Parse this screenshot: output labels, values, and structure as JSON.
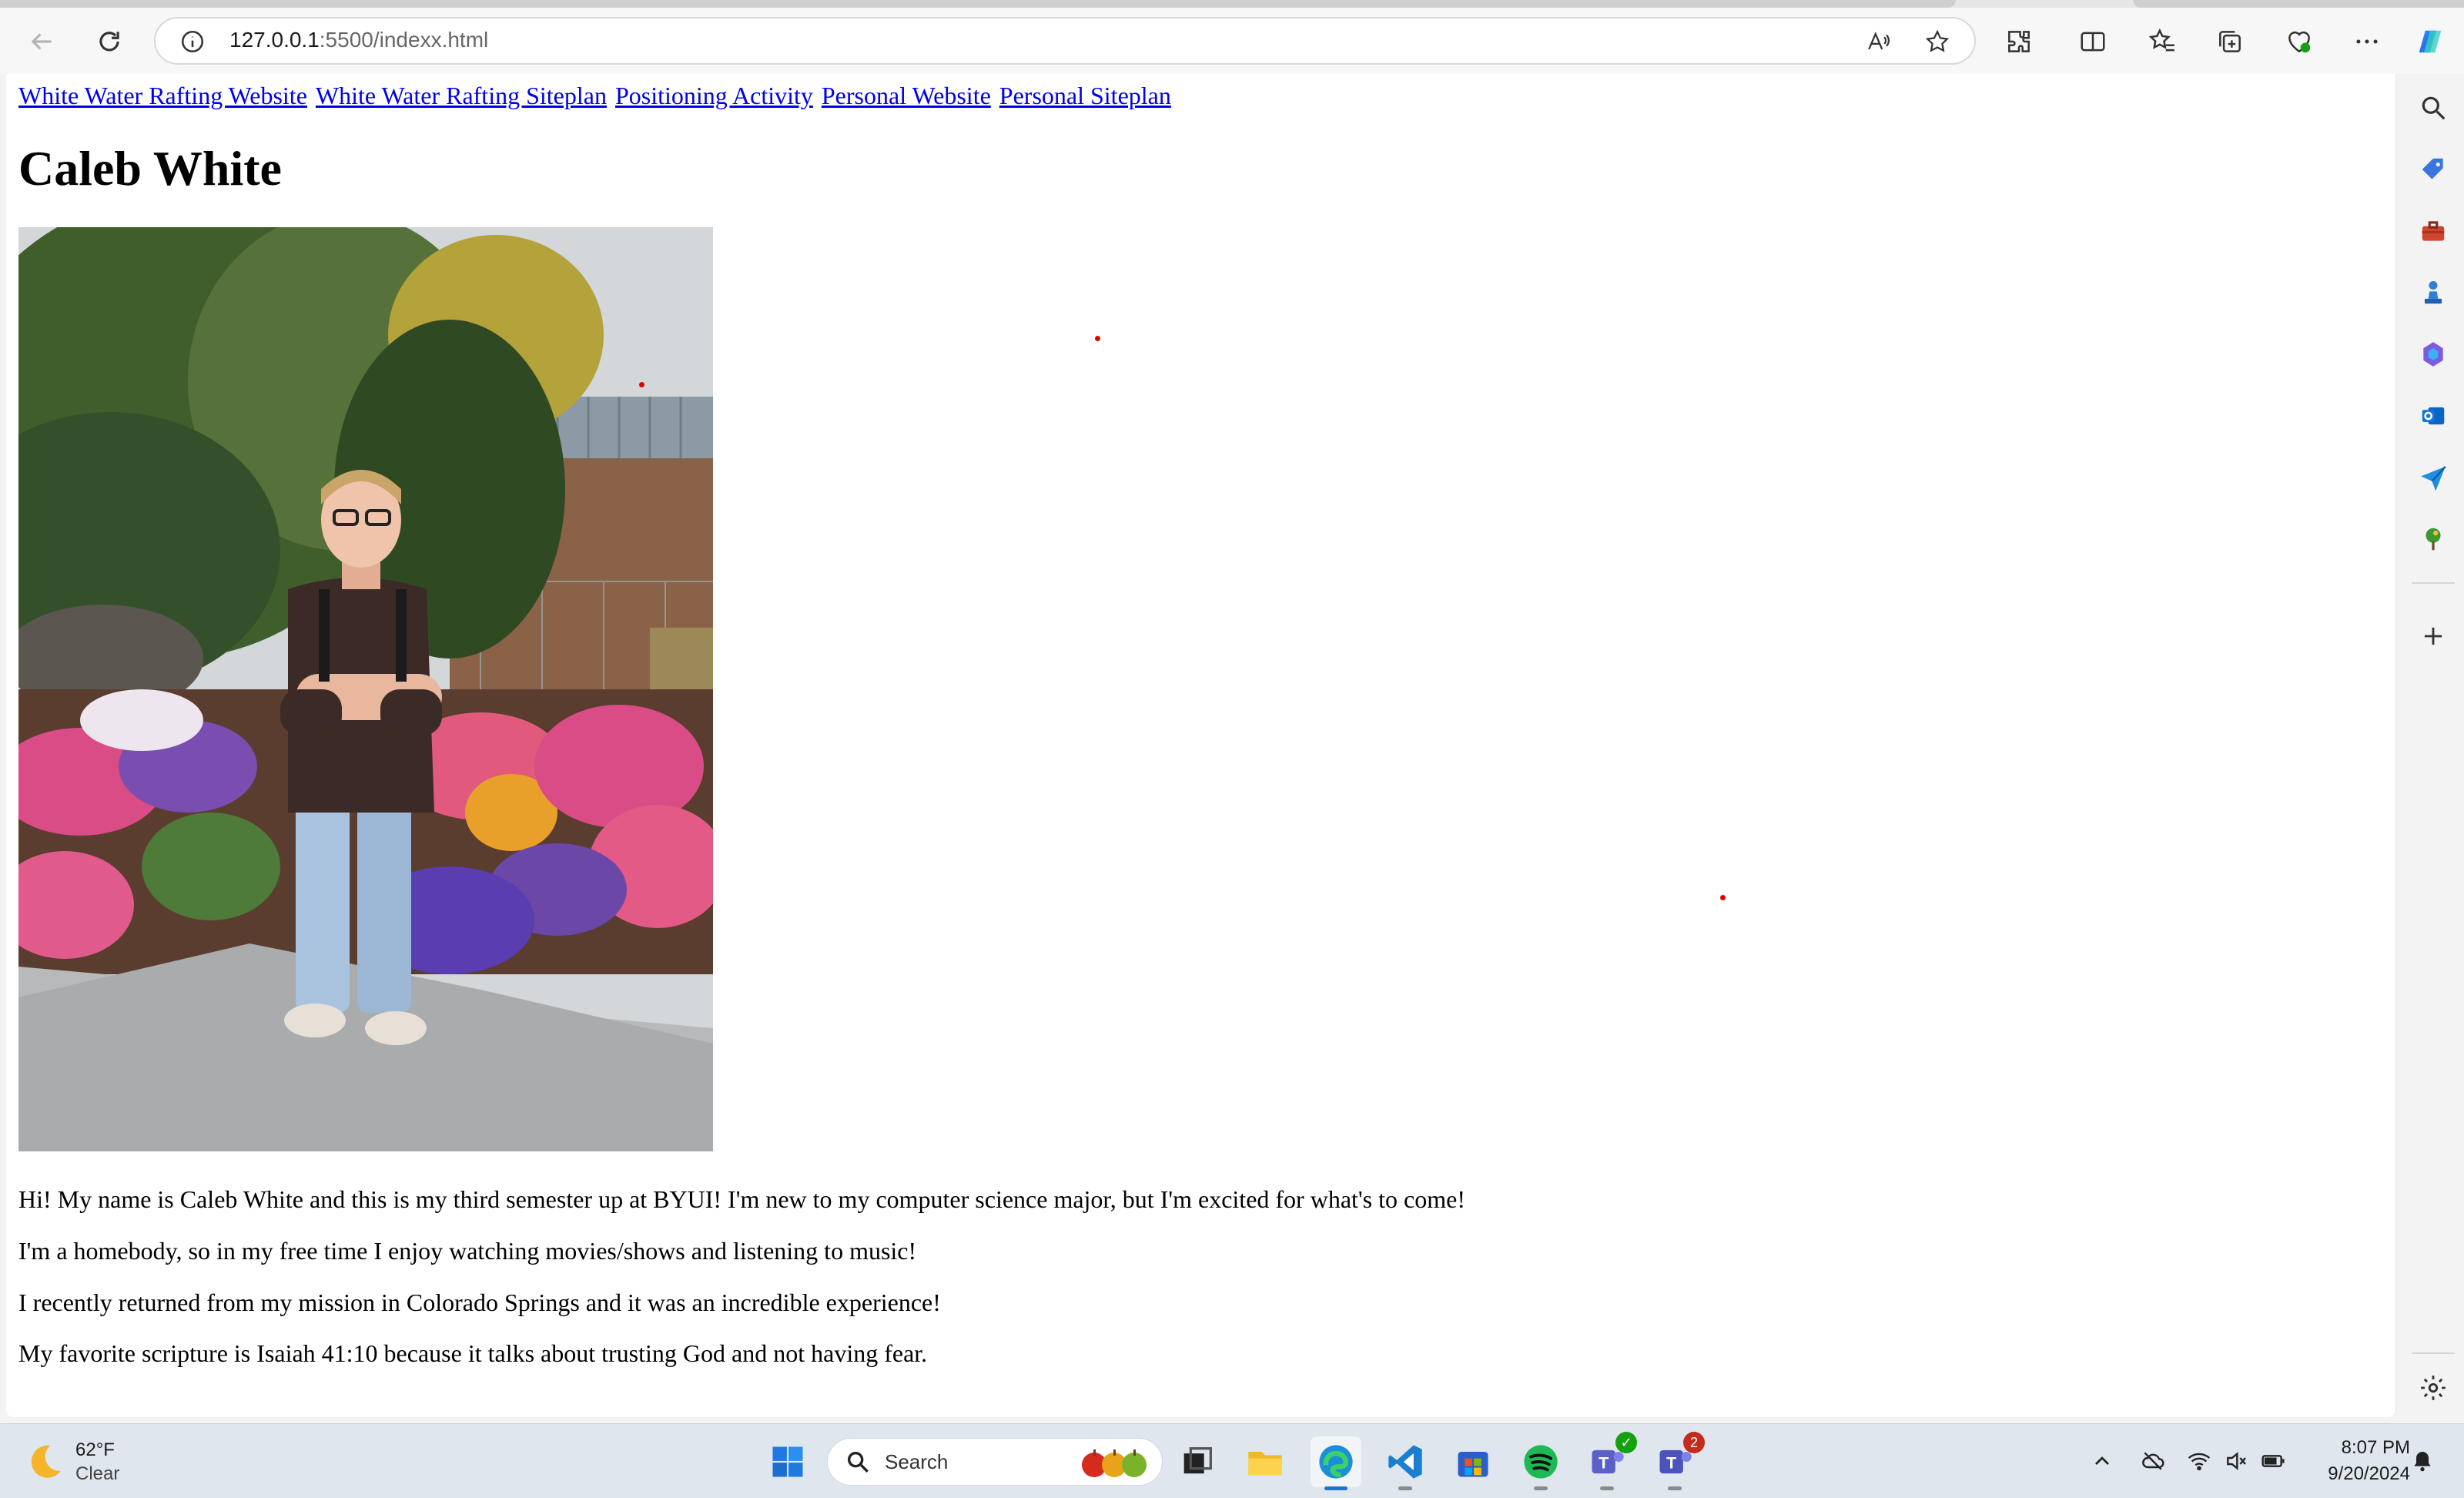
{
  "browser": {
    "url_host": "127.0.0.1",
    "url_path": ":5500/indexx.html"
  },
  "page": {
    "nav_links": [
      "White Water Rafting Website",
      "White Water Rafting Siteplan",
      "Positioning Activity",
      "Personal Website",
      "Personal Siteplan"
    ],
    "heading": "Caleb White",
    "paragraphs": [
      "Hi! My name is Caleb White and this is my third semester up at BYUI! I'm new to my computer science major, but I'm excited for what's to come!",
      "I'm a homebody, so in my free time I enjoy watching movies/shows and listening to music!",
      "I recently returned from my mission in Colorado Springs and it was an incredible experience!",
      "My favorite scripture is Isaiah 41:10 because it talks about trusting God and not having fear."
    ]
  },
  "taskbar": {
    "weather_temp": "62°F",
    "weather_condition": "Clear",
    "search_label": "Search",
    "time": "8:07 PM",
    "date": "9/20/2024",
    "teams_badge": "2"
  },
  "colors": {
    "link": "#0000ee",
    "accent": "#1f6fd6"
  }
}
